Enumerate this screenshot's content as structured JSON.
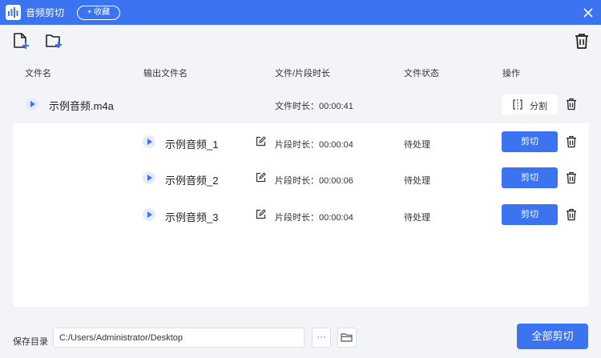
{
  "window": {
    "title": "音频剪切",
    "favorite_label": "+ 收藏",
    "accent_color": "#3b73f0"
  },
  "toolbar": {
    "icons": [
      "add-file-icon",
      "add-folder-icon",
      "trash-icon"
    ]
  },
  "table": {
    "headers": {
      "file_name": "文件名",
      "output_name": "输出文件名",
      "duration": "文件/片段时长",
      "status": "文件状态",
      "action": "操作"
    },
    "file": {
      "name": "示例音频.m4a",
      "duration": "文件时长：00:00:41",
      "split_label": "分割"
    },
    "clips": [
      {
        "name": "示例音频_1",
        "duration": "片段时长：00:00:04",
        "status": "待处理",
        "action": "剪切"
      },
      {
        "name": "示例音频_2",
        "duration": "片段时长：00:00:06",
        "status": "待处理",
        "action": "剪切"
      },
      {
        "name": "示例音频_3",
        "duration": "片段时长：00:00:04",
        "status": "待处理",
        "action": "剪切"
      }
    ]
  },
  "footer": {
    "save_label": "保存目录",
    "save_path": "C:/Users/Administrator/Desktop",
    "browse_label": "···",
    "cut_all_label": "全部剪切"
  }
}
